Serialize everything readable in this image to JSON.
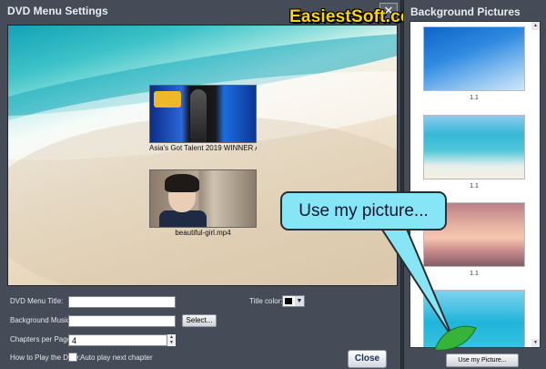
{
  "dialog": {
    "title": "DVD Menu Settings",
    "close_icon": "close-icon",
    "close_glyph": "✕",
    "logo_text": "EasiestSoft.com",
    "preview": {
      "chapters": [
        {
          "title": "Asia's Got Talent 2019 WINNER A"
        },
        {
          "title": "beautiful-girl.mp4"
        }
      ]
    },
    "form": {
      "title_label": "DVD Menu Title:",
      "title_value": "",
      "music_label": "Background Music:",
      "music_value": "",
      "select_button": "Select...",
      "per_page_label": "Chapters per Page:",
      "per_page_value": "4",
      "spin_up": "▲",
      "spin_down": "▼",
      "howto_label": "How to Play the DVD:",
      "autoplay_label": "Auto play next chapter",
      "autoplay_checked": false,
      "title_color_label": "Title color:",
      "title_color_value": "#000000",
      "color_arrow": "▼",
      "close_button": "Close"
    }
  },
  "bg_panel": {
    "title": "Background Pictures",
    "items": [
      {
        "label": "1.1"
      },
      {
        "label": "1.1"
      },
      {
        "label": "1.1"
      },
      {
        "label": ""
      }
    ],
    "scroll_up": "▲",
    "scroll_down": "▼",
    "use_button": "Use my Picture..."
  },
  "callout": {
    "text": "Use my picture..."
  },
  "colors": {
    "dialog_bg": "#464c57",
    "callout_bg": "#86e6f6",
    "logo": "#ffd400"
  }
}
